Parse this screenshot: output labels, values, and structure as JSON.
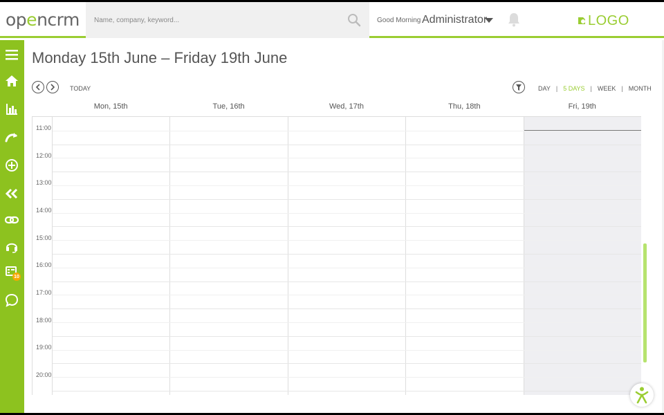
{
  "brand": {
    "name_pre": "op",
    "name_o": "e",
    "name_post": "ncrm"
  },
  "search": {
    "placeholder": "Name, company, keyword..."
  },
  "header": {
    "greeting": "Good Morning",
    "user": "Administrator",
    "logo_text": "LOGO"
  },
  "sidebar": {
    "items": [
      {
        "icon": "menu-icon"
      },
      {
        "icon": "home-icon"
      },
      {
        "icon": "bar-chart-icon"
      },
      {
        "icon": "pipeline-icon"
      },
      {
        "icon": "add-circle-icon"
      },
      {
        "icon": "double-chevron-left-icon"
      },
      {
        "icon": "link-icon"
      },
      {
        "icon": "headset-icon"
      },
      {
        "icon": "calendar-tasks-icon",
        "badge": "10"
      },
      {
        "icon": "chat-icon"
      }
    ]
  },
  "calendar": {
    "title": "Monday 15th June – Friday 19th June",
    "today_label": "TODAY",
    "views": [
      "DAY",
      "5 DAYS",
      "WEEK",
      "MONTH"
    ],
    "active_view": "5 DAYS",
    "days": [
      "Mon, 15th",
      "Tue, 16th",
      "Wed, 17th",
      "Thu, 18th",
      "Fri, 19th"
    ],
    "today_index": 4,
    "times": [
      "11:00",
      "12:00",
      "13:00",
      "14:00",
      "15:00",
      "16:00",
      "17:00",
      "18:00",
      "19:00",
      "20:00"
    ]
  },
  "colors": {
    "accent": "#8dc21f",
    "badge": "#f6a800",
    "today_bg": "#efeff2"
  }
}
